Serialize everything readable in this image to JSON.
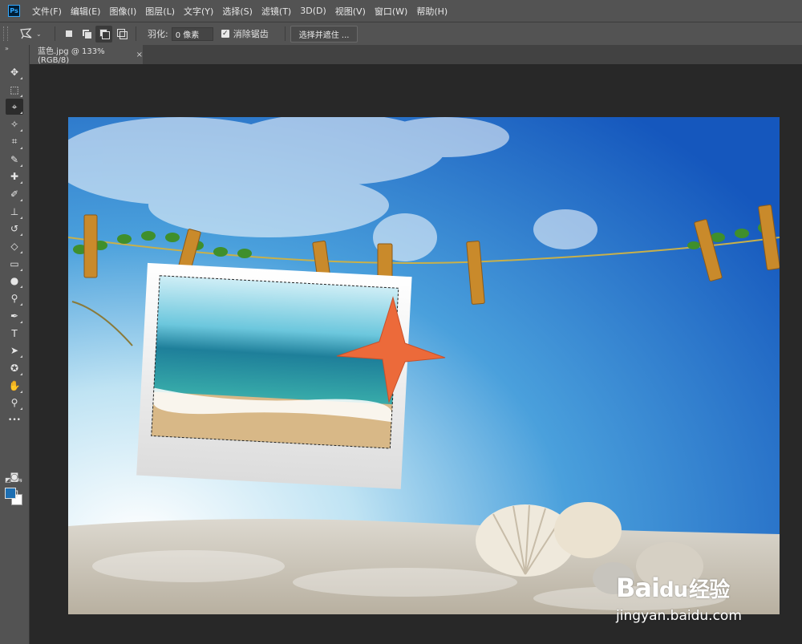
{
  "app": {
    "logo_text": "Ps",
    "menu": [
      "文件(F)",
      "编辑(E)",
      "图像(I)",
      "图层(L)",
      "文字(Y)",
      "选择(S)",
      "滤镜(T)",
      "3D(D)",
      "视图(V)",
      "窗口(W)",
      "帮助(H)"
    ]
  },
  "options": {
    "tool_preset_icon": "lasso-icon",
    "feather_label": "羽化:",
    "feather_value": "0 像素",
    "antialias_label": "消除锯齿",
    "antialias_checked": true,
    "select_mask_label": "选择并遮住 ..."
  },
  "document": {
    "tab_label": "蓝色.jpg @ 133%(RGB/8)",
    "close_glyph": "×"
  },
  "tools": [
    {
      "name": "move-tool",
      "glyph": "✥"
    },
    {
      "name": "marquee-tool",
      "glyph": "⬚"
    },
    {
      "name": "polygonal-lasso-tool",
      "glyph": "⌖",
      "active": true
    },
    {
      "name": "magic-wand-tool",
      "glyph": "✧"
    },
    {
      "name": "crop-tool",
      "glyph": "⌗"
    },
    {
      "name": "eyedropper-tool",
      "glyph": "✎"
    },
    {
      "name": "healing-brush-tool",
      "glyph": "✚"
    },
    {
      "name": "brush-tool",
      "glyph": "✐"
    },
    {
      "name": "clone-stamp-tool",
      "glyph": "⊥"
    },
    {
      "name": "history-brush-tool",
      "glyph": "↺"
    },
    {
      "name": "eraser-tool",
      "glyph": "◇"
    },
    {
      "name": "gradient-tool",
      "glyph": "▭"
    },
    {
      "name": "blur-tool",
      "glyph": "●"
    },
    {
      "name": "dodge-tool",
      "glyph": "⚲"
    },
    {
      "name": "pen-tool",
      "glyph": "✒"
    },
    {
      "name": "type-tool",
      "glyph": "T"
    },
    {
      "name": "path-selection-tool",
      "glyph": "➤"
    },
    {
      "name": "custom-shape-tool",
      "glyph": "✪"
    },
    {
      "name": "hand-tool",
      "glyph": "✋"
    },
    {
      "name": "zoom-tool",
      "glyph": "⚲"
    },
    {
      "name": "more-tools",
      "glyph": "•••"
    }
  ],
  "colors": {
    "foreground": "#1e6fb2",
    "background": "#ffffff"
  },
  "watermark": {
    "brand": "Bai",
    "brand_paw": "du",
    "brand_cn": "经验",
    "url": "jingyan.baidu.com"
  }
}
